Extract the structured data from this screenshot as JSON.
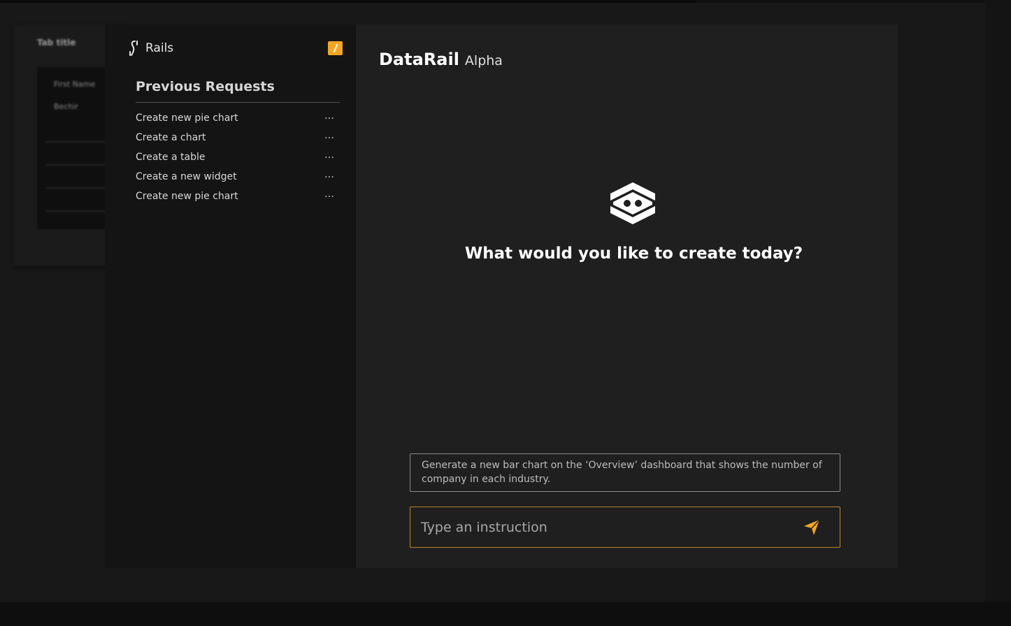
{
  "background_app": {
    "tab_title": "Tab title",
    "table": {
      "header": "First Name",
      "first_cell": "Bechir"
    }
  },
  "sidebar": {
    "brand_name": "Rails",
    "section_title": "Previous Requests",
    "requests": [
      {
        "label": "Create new pie chart",
        "more": "…"
      },
      {
        "label": "Create a chart",
        "more": "…"
      },
      {
        "label": "Create a table",
        "more": "…"
      },
      {
        "label": "Create a new widget",
        "more": "…"
      },
      {
        "label": "Create new pie chart",
        "more": "…"
      }
    ]
  },
  "main": {
    "title": "DataRail",
    "tag": "Alpha",
    "headline": "What would you like to create today?",
    "suggestion": "Generate a new bar chart on the ‘Overview’ dashboard that shows the number of company in each industry.",
    "input": {
      "placeholder": "Type an instruction",
      "value": ""
    }
  },
  "colors": {
    "accent": "#f5a623",
    "modal_sidebar": "#141414",
    "modal_main": "#1f1f1f",
    "page_background": "#111111"
  },
  "icons": {
    "brand": "rails-logo-icon",
    "edit": "pencil-icon",
    "assistant": "bot-face-icon",
    "send": "paper-plane-icon"
  }
}
